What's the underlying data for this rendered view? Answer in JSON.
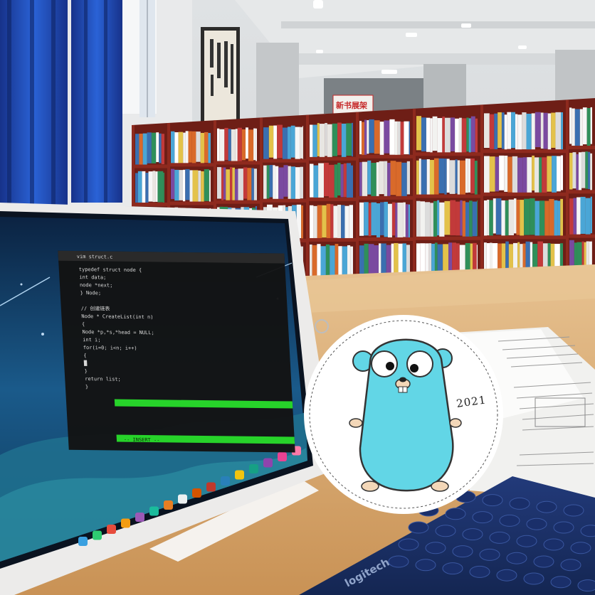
{
  "scene": {
    "sign_text": "新书展架",
    "terminal_title": "vim struct.c",
    "code_lines": [
      "typedef struct node {",
      "    int data;",
      "    node *next;",
      "} Node;",
      "",
      "// 创建链表",
      "Node * CreateList(int n)",
      "{",
      "    Node *p,*s,*head = NULL;",
      "    int i;",
      "    for(i=0; i<n; i++)",
      "    {",
      "        █",
      "    }",
      "    return list;",
      "}"
    ],
    "status_line": "-- INSERT --",
    "mascot_year": "2021",
    "keyboard_brand": "logitech"
  },
  "colors": {
    "mascot": "#62d6e6",
    "shelf": "#8e2a1e",
    "table": "#d9a86a",
    "curtain": "#1f4fb8",
    "terminal_status": "#27d32a"
  }
}
